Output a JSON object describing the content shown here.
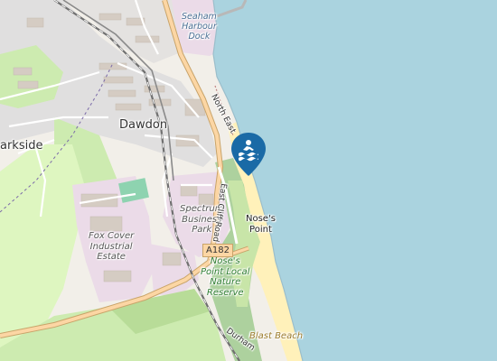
{
  "map": {
    "places": {
      "dawdon": "Dawdon",
      "parkside": "arkside"
    },
    "areas": {
      "seaham_harbour_dock": [
        "Seaham",
        "Harbour",
        "Dock"
      ],
      "spectrum_business_park": [
        "Spectrum",
        "Business",
        "Park"
      ],
      "fox_cover_industrial_estate": [
        "Fox Cover",
        "Industrial",
        "Estate"
      ],
      "noses_point_reserve": [
        "Nose's",
        "Point Local",
        "Nature",
        "Reserve"
      ]
    },
    "features": {
      "noses_point": [
        "Nose's",
        "Point"
      ],
      "blast_beach": "Blast Beach"
    },
    "roads": {
      "north_east": "North East",
      "east_cliff_road": "East Cliff Road",
      "a182": "A182",
      "durham": "Durham"
    },
    "marker": {
      "icon": "swimming-icon",
      "color": "#1a6aa6"
    },
    "colors": {
      "sea": "#aad3df",
      "land": "#f2efe9",
      "residential": "#e0dfdf",
      "industrial": "#ebdbe8",
      "grass": "#cdebb0",
      "golf": "#def6c0",
      "wood": "#add19e",
      "beach": "#fff1ba",
      "primary_road": "#fcd6a4",
      "railway": "#888888"
    }
  }
}
